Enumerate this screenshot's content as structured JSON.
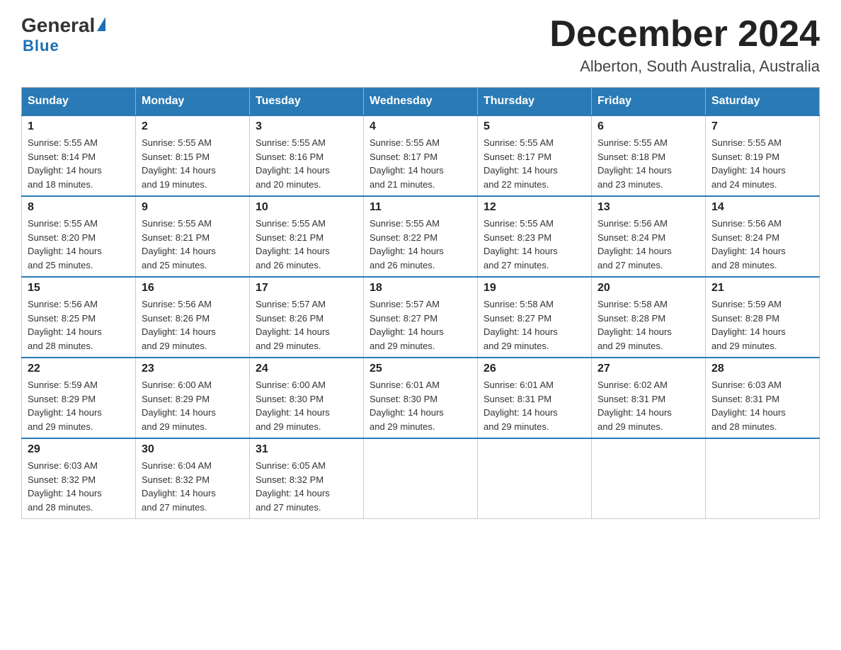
{
  "logo": {
    "general": "General",
    "blue": "Blue"
  },
  "title": "December 2024",
  "subtitle": "Alberton, South Australia, Australia",
  "days_of_week": [
    "Sunday",
    "Monday",
    "Tuesday",
    "Wednesday",
    "Thursday",
    "Friday",
    "Saturday"
  ],
  "weeks": [
    [
      {
        "day": 1,
        "sunrise": "5:55 AM",
        "sunset": "8:14 PM",
        "daylight": "14 hours and 18 minutes."
      },
      {
        "day": 2,
        "sunrise": "5:55 AM",
        "sunset": "8:15 PM",
        "daylight": "14 hours and 19 minutes."
      },
      {
        "day": 3,
        "sunrise": "5:55 AM",
        "sunset": "8:16 PM",
        "daylight": "14 hours and 20 minutes."
      },
      {
        "day": 4,
        "sunrise": "5:55 AM",
        "sunset": "8:17 PM",
        "daylight": "14 hours and 21 minutes."
      },
      {
        "day": 5,
        "sunrise": "5:55 AM",
        "sunset": "8:17 PM",
        "daylight": "14 hours and 22 minutes."
      },
      {
        "day": 6,
        "sunrise": "5:55 AM",
        "sunset": "8:18 PM",
        "daylight": "14 hours and 23 minutes."
      },
      {
        "day": 7,
        "sunrise": "5:55 AM",
        "sunset": "8:19 PM",
        "daylight": "14 hours and 24 minutes."
      }
    ],
    [
      {
        "day": 8,
        "sunrise": "5:55 AM",
        "sunset": "8:20 PM",
        "daylight": "14 hours and 25 minutes."
      },
      {
        "day": 9,
        "sunrise": "5:55 AM",
        "sunset": "8:21 PM",
        "daylight": "14 hours and 25 minutes."
      },
      {
        "day": 10,
        "sunrise": "5:55 AM",
        "sunset": "8:21 PM",
        "daylight": "14 hours and 26 minutes."
      },
      {
        "day": 11,
        "sunrise": "5:55 AM",
        "sunset": "8:22 PM",
        "daylight": "14 hours and 26 minutes."
      },
      {
        "day": 12,
        "sunrise": "5:55 AM",
        "sunset": "8:23 PM",
        "daylight": "14 hours and 27 minutes."
      },
      {
        "day": 13,
        "sunrise": "5:56 AM",
        "sunset": "8:24 PM",
        "daylight": "14 hours and 27 minutes."
      },
      {
        "day": 14,
        "sunrise": "5:56 AM",
        "sunset": "8:24 PM",
        "daylight": "14 hours and 28 minutes."
      }
    ],
    [
      {
        "day": 15,
        "sunrise": "5:56 AM",
        "sunset": "8:25 PM",
        "daylight": "14 hours and 28 minutes."
      },
      {
        "day": 16,
        "sunrise": "5:56 AM",
        "sunset": "8:26 PM",
        "daylight": "14 hours and 29 minutes."
      },
      {
        "day": 17,
        "sunrise": "5:57 AM",
        "sunset": "8:26 PM",
        "daylight": "14 hours and 29 minutes."
      },
      {
        "day": 18,
        "sunrise": "5:57 AM",
        "sunset": "8:27 PM",
        "daylight": "14 hours and 29 minutes."
      },
      {
        "day": 19,
        "sunrise": "5:58 AM",
        "sunset": "8:27 PM",
        "daylight": "14 hours and 29 minutes."
      },
      {
        "day": 20,
        "sunrise": "5:58 AM",
        "sunset": "8:28 PM",
        "daylight": "14 hours and 29 minutes."
      },
      {
        "day": 21,
        "sunrise": "5:59 AM",
        "sunset": "8:28 PM",
        "daylight": "14 hours and 29 minutes."
      }
    ],
    [
      {
        "day": 22,
        "sunrise": "5:59 AM",
        "sunset": "8:29 PM",
        "daylight": "14 hours and 29 minutes."
      },
      {
        "day": 23,
        "sunrise": "6:00 AM",
        "sunset": "8:29 PM",
        "daylight": "14 hours and 29 minutes."
      },
      {
        "day": 24,
        "sunrise": "6:00 AM",
        "sunset": "8:30 PM",
        "daylight": "14 hours and 29 minutes."
      },
      {
        "day": 25,
        "sunrise": "6:01 AM",
        "sunset": "8:30 PM",
        "daylight": "14 hours and 29 minutes."
      },
      {
        "day": 26,
        "sunrise": "6:01 AM",
        "sunset": "8:31 PM",
        "daylight": "14 hours and 29 minutes."
      },
      {
        "day": 27,
        "sunrise": "6:02 AM",
        "sunset": "8:31 PM",
        "daylight": "14 hours and 29 minutes."
      },
      {
        "day": 28,
        "sunrise": "6:03 AM",
        "sunset": "8:31 PM",
        "daylight": "14 hours and 28 minutes."
      }
    ],
    [
      {
        "day": 29,
        "sunrise": "6:03 AM",
        "sunset": "8:32 PM",
        "daylight": "14 hours and 28 minutes."
      },
      {
        "day": 30,
        "sunrise": "6:04 AM",
        "sunset": "8:32 PM",
        "daylight": "14 hours and 27 minutes."
      },
      {
        "day": 31,
        "sunrise": "6:05 AM",
        "sunset": "8:32 PM",
        "daylight": "14 hours and 27 minutes."
      },
      null,
      null,
      null,
      null
    ]
  ],
  "labels": {
    "sunrise": "Sunrise:",
    "sunset": "Sunset:",
    "daylight": "Daylight:"
  }
}
